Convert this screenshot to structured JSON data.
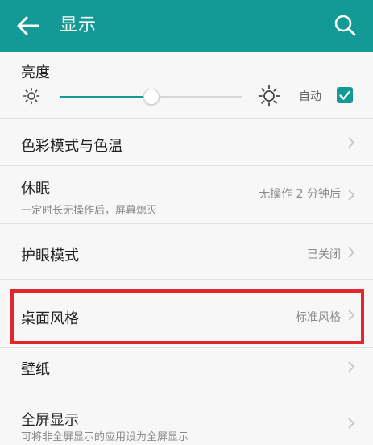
{
  "appbar": {
    "title": "显示",
    "back_icon": "arrow-left-icon",
    "search_icon": "search-icon",
    "color": "#139a97"
  },
  "brightness": {
    "label": "亮度",
    "level": 0.5,
    "auto_label": "自动",
    "auto_checked": true
  },
  "settings": {
    "color_mode": {
      "label": "色彩模式与色温"
    },
    "sleep": {
      "label": "休眠",
      "subtitle": "一定时长无操作后，屏幕熄灭",
      "value": "无操作 2 分钟后"
    },
    "eye_comfort": {
      "label": "护眼模式",
      "value": "已关闭"
    },
    "desktop_style": {
      "label": "桌面风格",
      "value": "标准风格"
    },
    "wallpaper": {
      "label": "壁纸"
    },
    "full_screen": {
      "label": "全屏显示",
      "subtitle": "可将非全屏显示的应用设为全屏显示"
    }
  },
  "highlight_color": "#e3262b"
}
